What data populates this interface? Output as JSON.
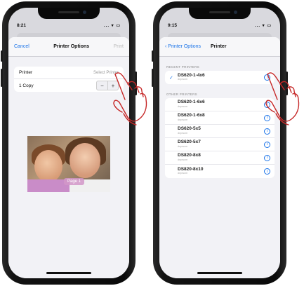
{
  "left_screen": {
    "status_time": "8:21",
    "status_icons": "... ▾ ▭",
    "nav": {
      "cancel": "Cancel",
      "title": "Printer Options",
      "print": "Print"
    },
    "rows": {
      "printer_label": "Printer",
      "printer_value": "Select Printer",
      "copies_label": "1 Copy",
      "minus": "−",
      "plus": "+"
    },
    "preview_label": "Page 1"
  },
  "right_screen": {
    "status_time": "9:15",
    "status_icons": "... ▾ ▭",
    "nav": {
      "back": "Printer Options",
      "title": "Printer"
    },
    "recent_header": "RECENT PRINTERS",
    "recent": [
      {
        "name": "DS620-1-4x6",
        "domain": "dnpwcm",
        "selected": true
      }
    ],
    "other_header": "OTHER PRINTERS",
    "others": [
      {
        "name": "DS620-1-6x6",
        "domain": "dnpwcm"
      },
      {
        "name": "DS620-1-6x8",
        "domain": "dnpwcm"
      },
      {
        "name": "DS620-5x5",
        "domain": "dnpwcm"
      },
      {
        "name": "DS620-5x7",
        "domain": "dnpwcm"
      },
      {
        "name": "DS820-8x8",
        "domain": "dnpwcm"
      },
      {
        "name": "DS820-8x10",
        "domain": "dnpwcm"
      }
    ]
  },
  "icons": {
    "check": "checkmark-icon",
    "info": "info-icon",
    "back": "chevron-left-icon"
  },
  "colors": {
    "accent": "#1a73e8",
    "hand_stroke": "#c62828"
  }
}
